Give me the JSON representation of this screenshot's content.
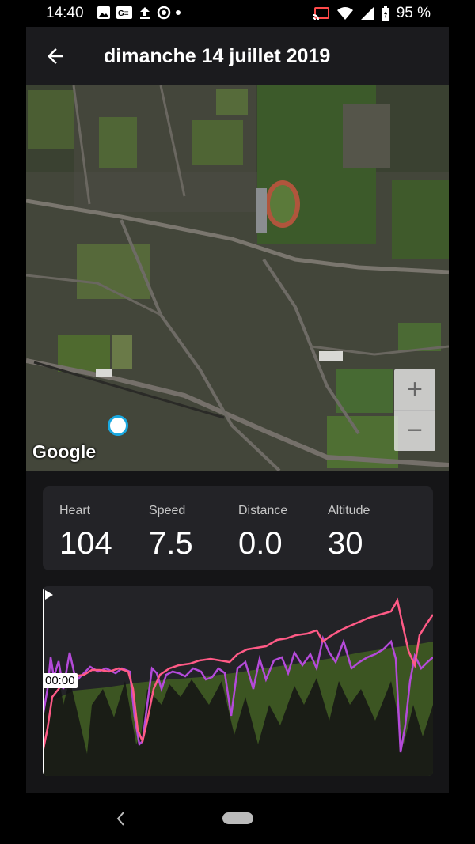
{
  "status_bar": {
    "time": "14:40",
    "battery_percent": "95 %",
    "left_icons": [
      "photo-icon",
      "news-icon",
      "upload-icon",
      "assistant-icon",
      "dot-icon"
    ],
    "right_icons": [
      "cast-icon",
      "wifi-icon",
      "signal-icon",
      "battery-icon"
    ]
  },
  "app_bar": {
    "title": "dimanche 14 juillet 2019",
    "back_icon": "arrow-back-icon"
  },
  "map": {
    "provider_logo": "Google",
    "zoom_in_label": "+",
    "zoom_out_label": "−"
  },
  "stats": {
    "heart_label": "Heart",
    "heart_value": "104",
    "speed_label": "Speed",
    "speed_value": "7.5",
    "distance_label": "Distance",
    "distance_value": "0.0",
    "altitude_label": "Altitude",
    "altitude_value": "30"
  },
  "graph": {
    "time_label": "00:00",
    "play_icon": "play-icon",
    "colors": {
      "heart": "#ff5a86",
      "speed": "#b44ad9",
      "altitude_fill": "#3f5b22",
      "shadow": "#111111"
    }
  },
  "nav_bar": {
    "back_icon": "nav-back-icon",
    "home_icon": "nav-home-pill"
  },
  "colors": {
    "background": "#151517",
    "app_bar": "#1b1b1e",
    "card": "#232327"
  }
}
